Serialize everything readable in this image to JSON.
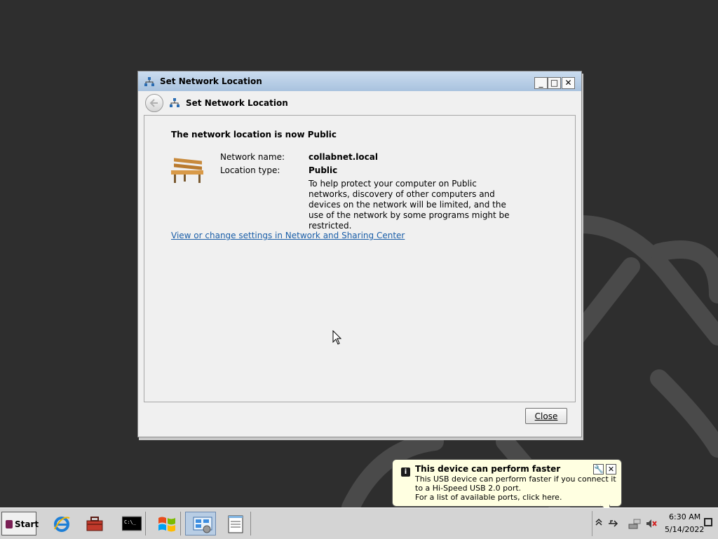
{
  "window": {
    "title": "Set Network Location",
    "nav_title": "Set Network Location",
    "headline": "The network location is now Public",
    "network_name_label": "Network name:",
    "network_name_value": "collabnet.local",
    "location_type_label": "Location type:",
    "location_type_value": "Public",
    "description": "To help protect your computer on Public networks, discovery of other computers and devices on the network will be limited, and the use of the network by some programs might be restricted.",
    "link": "View or change settings in Network and Sharing Center",
    "close_label": "Close",
    "controls": {
      "minimize": "_",
      "maximize": "□",
      "close": "✕"
    }
  },
  "balloon": {
    "title": "This device can perform faster",
    "line1": "This USB device can perform faster if you connect it to a Hi-Speed USB 2.0 port.",
    "line2": "For a list of available ports, click here."
  },
  "taskbar": {
    "start_label": "Start",
    "apps": [
      "internet-explorer-icon",
      "toolbox-icon",
      "command-prompt-icon",
      "windows-logo-icon",
      "control-panel-icon",
      "notepad-icon"
    ],
    "clock_time": "6:30 AM",
    "clock_date": "5/14/2022"
  },
  "colors": {
    "desktop": "#2e2e2e",
    "titlebar": "#a8c2de",
    "link": "#1a5ea8",
    "balloon": "#ffffe1",
    "taskbar": "#d4d4d4"
  }
}
